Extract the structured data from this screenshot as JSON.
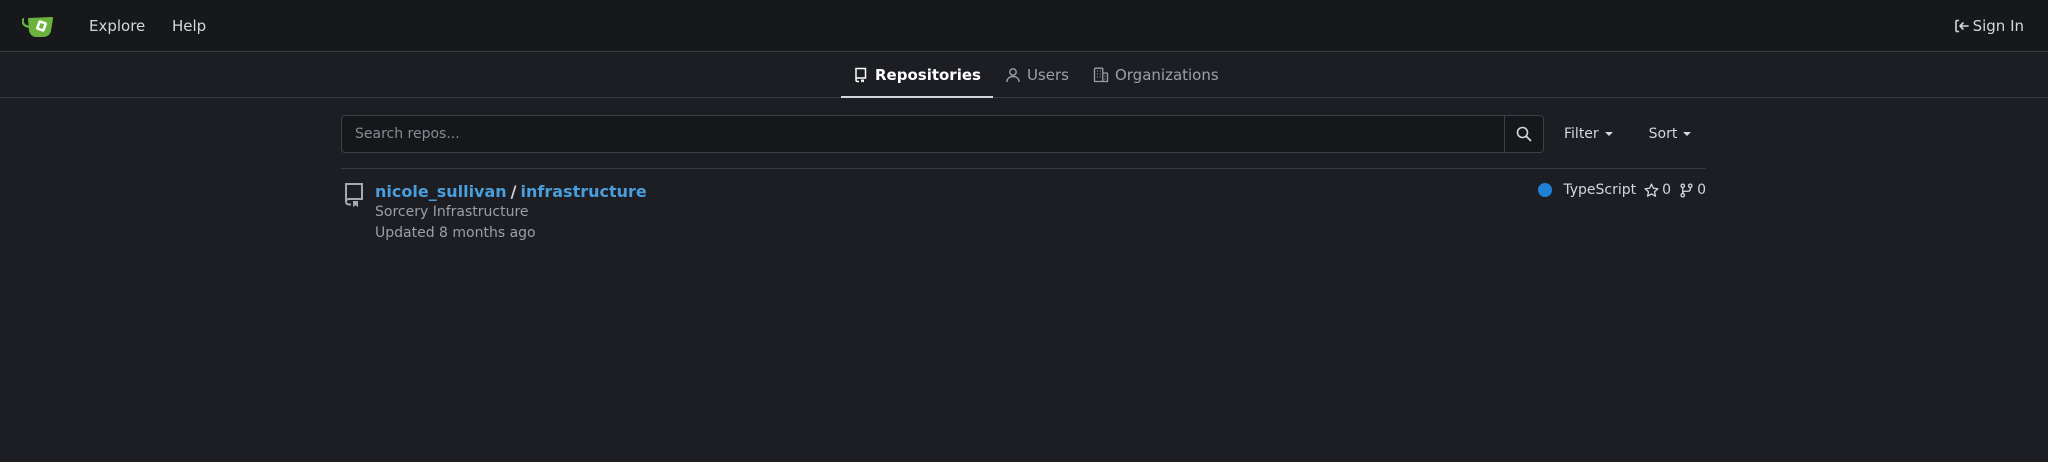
{
  "header": {
    "nav": {
      "explore": "Explore",
      "help": "Help"
    },
    "sign_in": "Sign In",
    "brand_color": "#6cb33e"
  },
  "tabs": [
    {
      "label": "Repositories",
      "icon": "repo-icon",
      "active": true
    },
    {
      "label": "Users",
      "icon": "person-icon",
      "active": false
    },
    {
      "label": "Organizations",
      "icon": "organization-icon",
      "active": false
    }
  ],
  "search": {
    "placeholder": "Search repos...",
    "value": "",
    "filter_label": "Filter",
    "sort_label": "Sort"
  },
  "repos": [
    {
      "owner": "nicole_sullivan",
      "separator": "/",
      "name": "infrastructure",
      "description": "Sorcery Infrastructure",
      "updated": "Updated 8 months ago",
      "language": "TypeScript",
      "language_color": "#1f80d8",
      "stars": "0",
      "forks": "0"
    }
  ]
}
